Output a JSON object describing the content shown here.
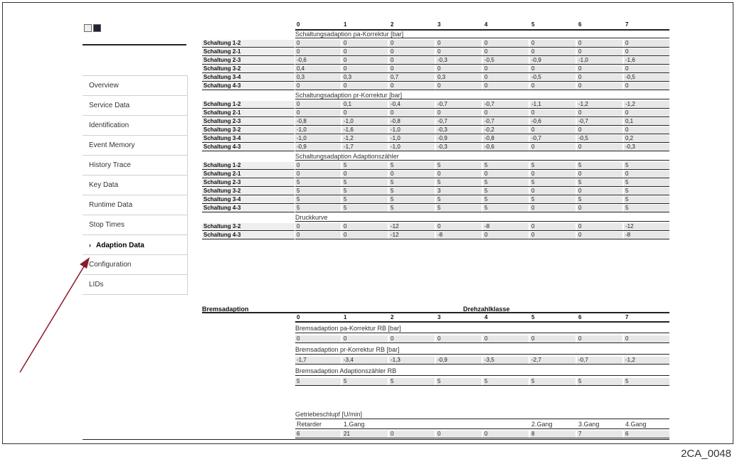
{
  "caption": "2CA_0048",
  "sidebar": {
    "items": [
      {
        "label": "Overview",
        "active": false
      },
      {
        "label": "Service Data",
        "active": false
      },
      {
        "label": "Identification",
        "active": false
      },
      {
        "label": "Event Memory",
        "active": false
      },
      {
        "label": "History Trace",
        "active": false
      },
      {
        "label": "Key Data",
        "active": false
      },
      {
        "label": "Runtime Data",
        "active": false
      },
      {
        "label": "Stop Times",
        "active": false
      },
      {
        "label": "Adaption Data",
        "active": true
      },
      {
        "label": "Configuration",
        "active": false
      },
      {
        "label": "LIDs",
        "active": false
      }
    ]
  },
  "columns": [
    "0",
    "1",
    "2",
    "3",
    "4",
    "5",
    "6",
    "7"
  ],
  "shift_sections": [
    {
      "title": "Schaltungsadaption pa-Korrektur [bar]",
      "rows": [
        {
          "label": "Schaltung 1-2",
          "values": [
            "0",
            "0",
            "0",
            "0",
            "0",
            "0",
            "0",
            "0"
          ]
        },
        {
          "label": "Schaltung 2-1",
          "values": [
            "0",
            "0",
            "0",
            "0",
            "0",
            "0",
            "0",
            "0"
          ]
        },
        {
          "label": "Schaltung 2-3",
          "values": [
            "-0,6",
            "0",
            "0",
            "-0,3",
            "-0,5",
            "-0,9",
            "-1,0",
            "-1,6"
          ]
        },
        {
          "label": "Schaltung 3-2",
          "values": [
            "0,4",
            "0",
            "0",
            "0",
            "0",
            "0",
            "0",
            "0"
          ]
        },
        {
          "label": "Schaltung 3-4",
          "values": [
            "0,3",
            "0,3",
            "0,7",
            "0,3",
            "0",
            "-0,5",
            "0",
            "-0,5"
          ]
        },
        {
          "label": "Schaltung 4-3",
          "values": [
            "0",
            "0",
            "0",
            "0",
            "0",
            "0",
            "0",
            "0"
          ]
        }
      ]
    },
    {
      "title": "Schaltungsadaption pr-Korrektur [bar]",
      "rows": [
        {
          "label": "Schaltung 1-2",
          "values": [
            "0",
            "0,1",
            "-0,4",
            "-0,7",
            "-0,7",
            "-1,1",
            "-1,2",
            "-1,2"
          ]
        },
        {
          "label": "Schaltung 2-1",
          "values": [
            "0",
            "0",
            "0",
            "0",
            "0",
            "0",
            "0",
            "0"
          ]
        },
        {
          "label": "Schaltung 2-3",
          "values": [
            "-0,8",
            "-1,0",
            "-0,8",
            "-0,7",
            "-0,7",
            "-0,6",
            "-0,7",
            "0,1"
          ]
        },
        {
          "label": "Schaltung 3-2",
          "values": [
            "-1,0",
            "-1,6",
            "-1,0",
            "-0,3",
            "-0,2",
            "0",
            "0",
            "0"
          ]
        },
        {
          "label": "Schaltung 3-4",
          "values": [
            "-1,0",
            "-1,2",
            "-1,0",
            "-0,9",
            "-0,8",
            "-0,7",
            "-0,5",
            "0,2"
          ]
        },
        {
          "label": "Schaltung 4-3",
          "values": [
            "-0,9",
            "-1,7",
            "-1,0",
            "-0,3",
            "-0,6",
            "0",
            "0",
            "-0,3"
          ]
        }
      ]
    },
    {
      "title": "Schaltungsadaption Adaptionszähler",
      "rows": [
        {
          "label": "Schaltung 1-2",
          "values": [
            "0",
            "5",
            "5",
            "5",
            "5",
            "5",
            "5",
            "5"
          ]
        },
        {
          "label": "Schaltung 2-1",
          "values": [
            "0",
            "0",
            "0",
            "0",
            "0",
            "0",
            "0",
            "0"
          ]
        },
        {
          "label": "Schaltung 2-3",
          "values": [
            "5",
            "5",
            "5",
            "5",
            "5",
            "5",
            "5",
            "5"
          ]
        },
        {
          "label": "Schaltung 3-2",
          "values": [
            "5",
            "5",
            "5",
            "3",
            "5",
            "0",
            "0",
            "5"
          ]
        },
        {
          "label": "Schaltung 3-4",
          "values": [
            "5",
            "5",
            "5",
            "5",
            "5",
            "5",
            "5",
            "5"
          ]
        },
        {
          "label": "Schaltung 4-3",
          "values": [
            "5",
            "5",
            "5",
            "5",
            "5",
            "0",
            "0",
            "5"
          ]
        }
      ]
    },
    {
      "title": "Druckkurve",
      "rows": [
        {
          "label": "Schaltung 3-2",
          "values": [
            "0",
            "0",
            "-12",
            "0",
            "-8",
            "0",
            "0",
            "-12"
          ]
        },
        {
          "label": "Schaltung 4-3",
          "values": [
            "0",
            "0",
            "-12",
            "-8",
            "0",
            "0",
            "0",
            "-8"
          ]
        }
      ]
    }
  ],
  "brake": {
    "title": "Bremsadaption",
    "group_label": "Drehzahlklasse",
    "sections": [
      {
        "title": "Bremsadaption pa-Korrektur RB [bar]",
        "values": [
          "0",
          "0",
          "0",
          "0",
          "0",
          "0",
          "0",
          "0"
        ]
      },
      {
        "title": "Bremsadaption pr-Korrektur RB [bar]",
        "values": [
          "-1,7",
          "-3,4",
          "-1,3",
          "-0,9",
          "-3,5",
          "-2,7",
          "-0,7",
          "-1,2"
        ]
      },
      {
        "title": "Bremsadaption Adaptionszähler RB",
        "values": [
          "5",
          "5",
          "5",
          "5",
          "5",
          "5",
          "5",
          "5"
        ]
      }
    ]
  },
  "slip": {
    "title": "Getriebeschlupf [U/min]",
    "headers": [
      "Retarder",
      "1.Gang",
      "",
      "",
      "",
      "2.Gang",
      "3.Gang",
      "4.Gang"
    ],
    "values": [
      "6",
      "21",
      "0",
      "0",
      "0",
      "8",
      "7",
      "6"
    ]
  }
}
